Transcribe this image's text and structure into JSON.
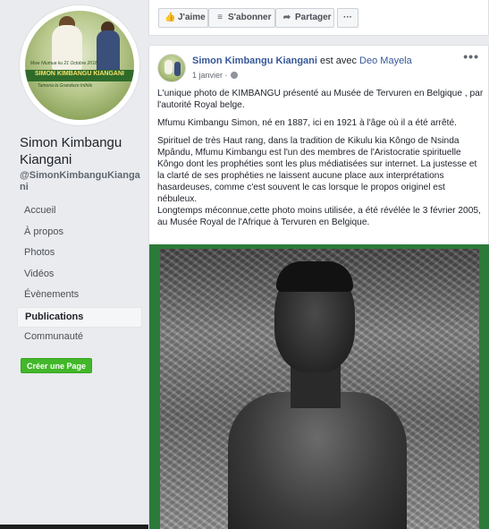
{
  "sidebar": {
    "profile_image": {
      "line1": "Mwe Ntumua ku 21 Octobre 2018",
      "line2": "SIMON KIMBANGU KIANGANI",
      "line3": "Tamona la Grandezo Inthile"
    },
    "page_name": "Simon Kimbangu Kiangani",
    "handle": "@SimonKimbanguKiangani",
    "nav": [
      {
        "label": "Accueil"
      },
      {
        "label": "À propos"
      },
      {
        "label": "Photos"
      },
      {
        "label": "Vidéos"
      },
      {
        "label": "Évènements"
      },
      {
        "label": "Publications"
      },
      {
        "label": "Communauté"
      }
    ],
    "create_page": "Créer une Page"
  },
  "actionbar": {
    "like": "J'aime",
    "follow": "S'abonner",
    "share": "Partager",
    "more": "···"
  },
  "post": {
    "author": "Simon Kimbangu Kiangani",
    "with_text": "est avec",
    "with_person": "Deo Mayela",
    "date": "1 janvier ·",
    "more": "•••",
    "paragraphs": [
      "L'unique photo de KIMBANGU présenté au Musée de Tervuren en Belgique , par l'autorité Royal belge.",
      "Mfumu Kimbangu Simon, né en 1887, ici en 1921 à l'âge où il a été arrêté.",
      "Spirituel de très Haut rang, dans la tradition de Kikulu kia Kôngo de Nsinda Mpându, Mfumu Kimbangu est l'un des membres de l'Aristocratie spirituelle Kôngo dont les prophéties sont les plus médiatisées sur internet. La justesse et la clarté de ses prophéties ne laissent aucune place aux interprétations hasardeuses, comme c'est souvent le cas lorsque le propos originel est nébuleux.",
      "Longtemps méconnue,cette photo moins utilisée, a été révélée le 3 février 2005, au Musée Royal de l'Afrique à Tervuren en Belgique."
    ]
  }
}
